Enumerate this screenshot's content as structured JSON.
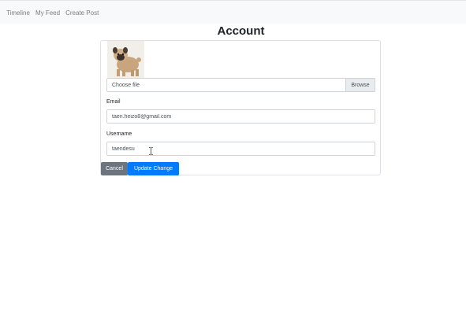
{
  "nav": {
    "links": [
      "Timeline",
      "My Feed",
      "Create Post"
    ]
  },
  "page": {
    "title": "Account"
  },
  "form": {
    "file": {
      "label": "Choose file",
      "browse_label": "Browse"
    },
    "email": {
      "label": "Email",
      "value": "taen.heizo8@gmail.com"
    },
    "username": {
      "label": "Username",
      "value": "taendesu"
    },
    "buttons": {
      "cancel_label": "Cancel",
      "update_label": "Update Change"
    }
  },
  "colors": {
    "navbar_bg": "#f8f9fa",
    "primary": "#007bff",
    "secondary": "#6c757d"
  },
  "icons": {
    "avatar": "pug-dog-photo",
    "cursor": "text-cursor-icon"
  }
}
